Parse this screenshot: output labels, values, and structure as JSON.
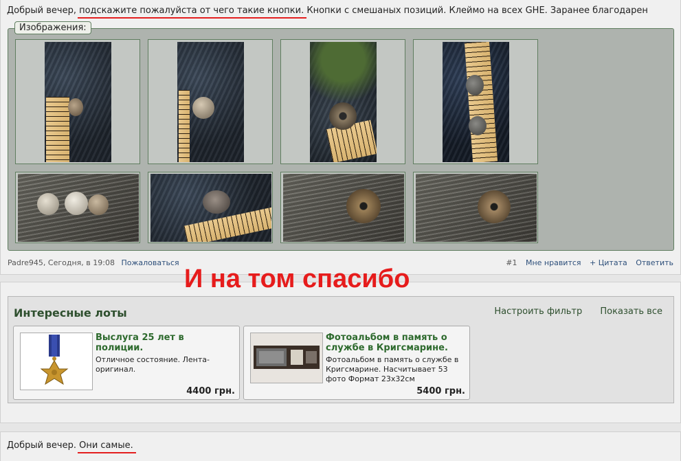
{
  "post1": {
    "text_a": "Добрый вечер, ",
    "text_underlined": "подскажите пожалуйста от чего такие кнопки.",
    "text_b": " Кнопки с смешаных позиций. Клеймо на всех GHE. Заранее благодарен",
    "attachments_label": "Изображения:",
    "author": "Padre945",
    "time": ", Сегодня, в 19:08",
    "report": "Пожаловаться",
    "post_number": "#1",
    "like": "Мне нравится",
    "quote": "+ Цитата",
    "reply": "Ответить"
  },
  "overlay_text": "И на том спасибо",
  "lots": {
    "title": "Интересные лоты",
    "filter_link": "Настроить фильтр",
    "show_all_link": "Показать все",
    "items": [
      {
        "title": "Выслуга 25 лет в полиции.",
        "desc": "Отличное состояние. Лента-оригинал.",
        "price": "4400 грн."
      },
      {
        "title": "Фотоальбом в память о службе в Кригсмарине.",
        "desc": "Фотоальбом в память о службе в Кригсмарине. Насчитывает 53 фото Формат 23х32см",
        "price": "5400 грн."
      }
    ]
  },
  "post3": {
    "text_a": "Добрый вечер. ",
    "text_underlined": "Они самые."
  }
}
